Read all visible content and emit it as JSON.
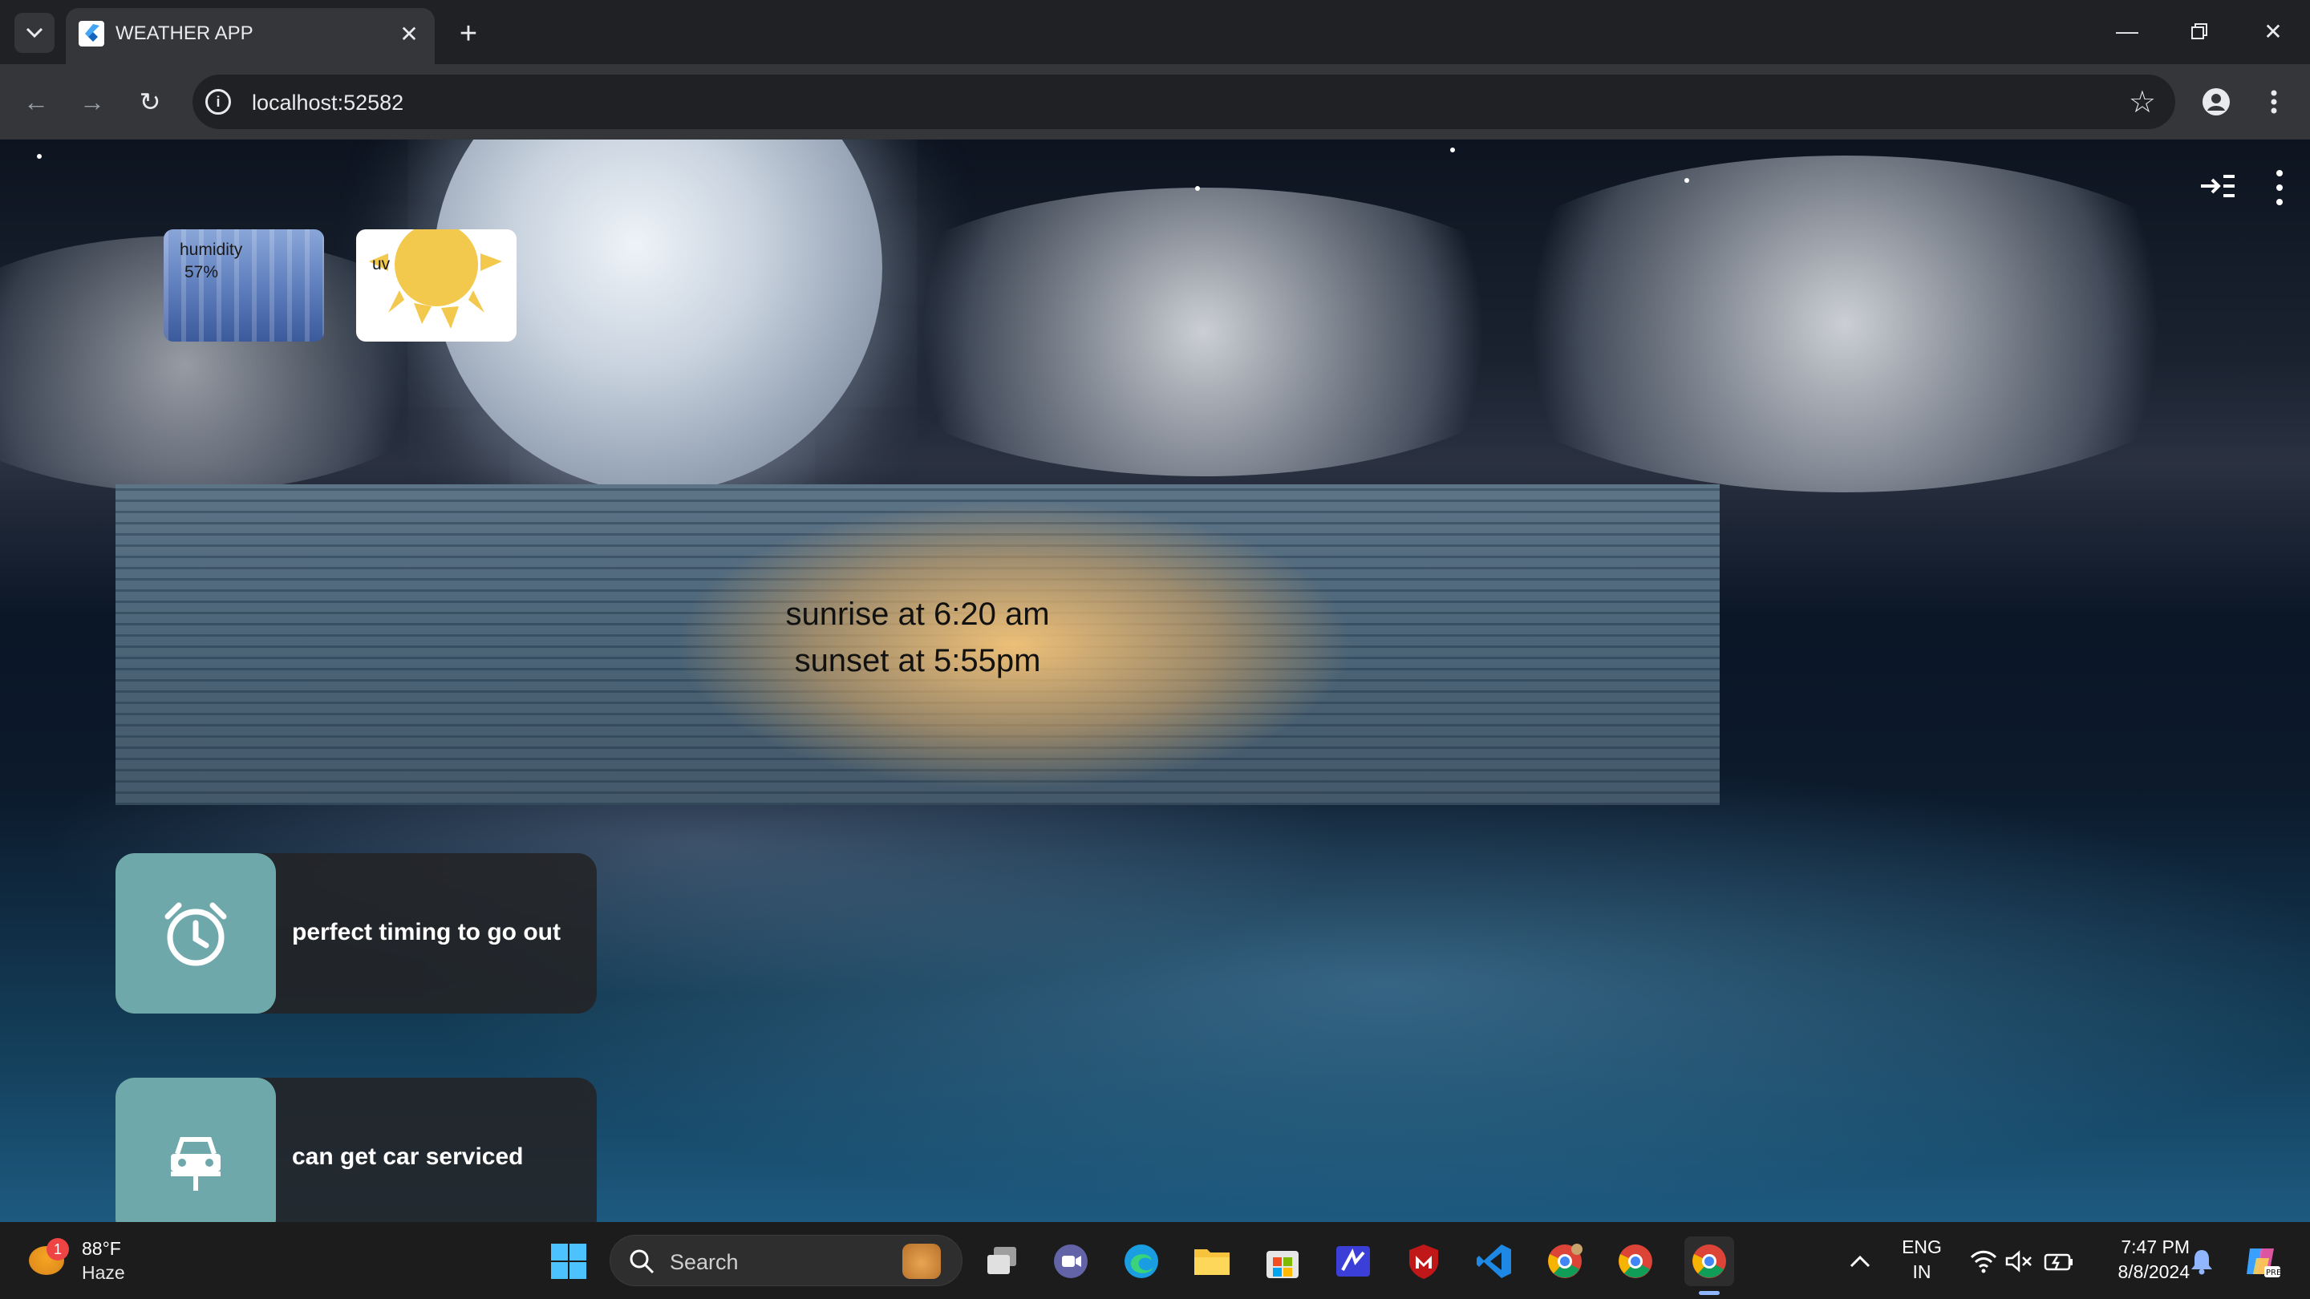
{
  "browser": {
    "tab_title": "WEATHER APP",
    "url": "localhost:52582"
  },
  "app": {
    "humidity": {
      "label": "humidity",
      "value": "57%"
    },
    "uv": {
      "label": "uv"
    },
    "sun": {
      "sunrise": "sunrise at 6:20 am",
      "sunset": "sunset at 5:55pm"
    },
    "tips": [
      {
        "text": "perfect timing to go out",
        "icon": "alarm-clock-icon"
      },
      {
        "text": "can get car serviced",
        "icon": "car-icon"
      }
    ]
  },
  "taskbar": {
    "weather": {
      "temp": "88°F",
      "condition": "Haze",
      "badge": "1"
    },
    "search_placeholder": "Search",
    "language": {
      "line1": "ENG",
      "line2": "IN"
    },
    "time": "7:47 PM",
    "date": "8/8/2024"
  },
  "colors": {
    "tip_icon_bg": "#6fa8ab",
    "sun_yellow": "#f2c94c",
    "accent_indicator": "#8fb6ff"
  }
}
